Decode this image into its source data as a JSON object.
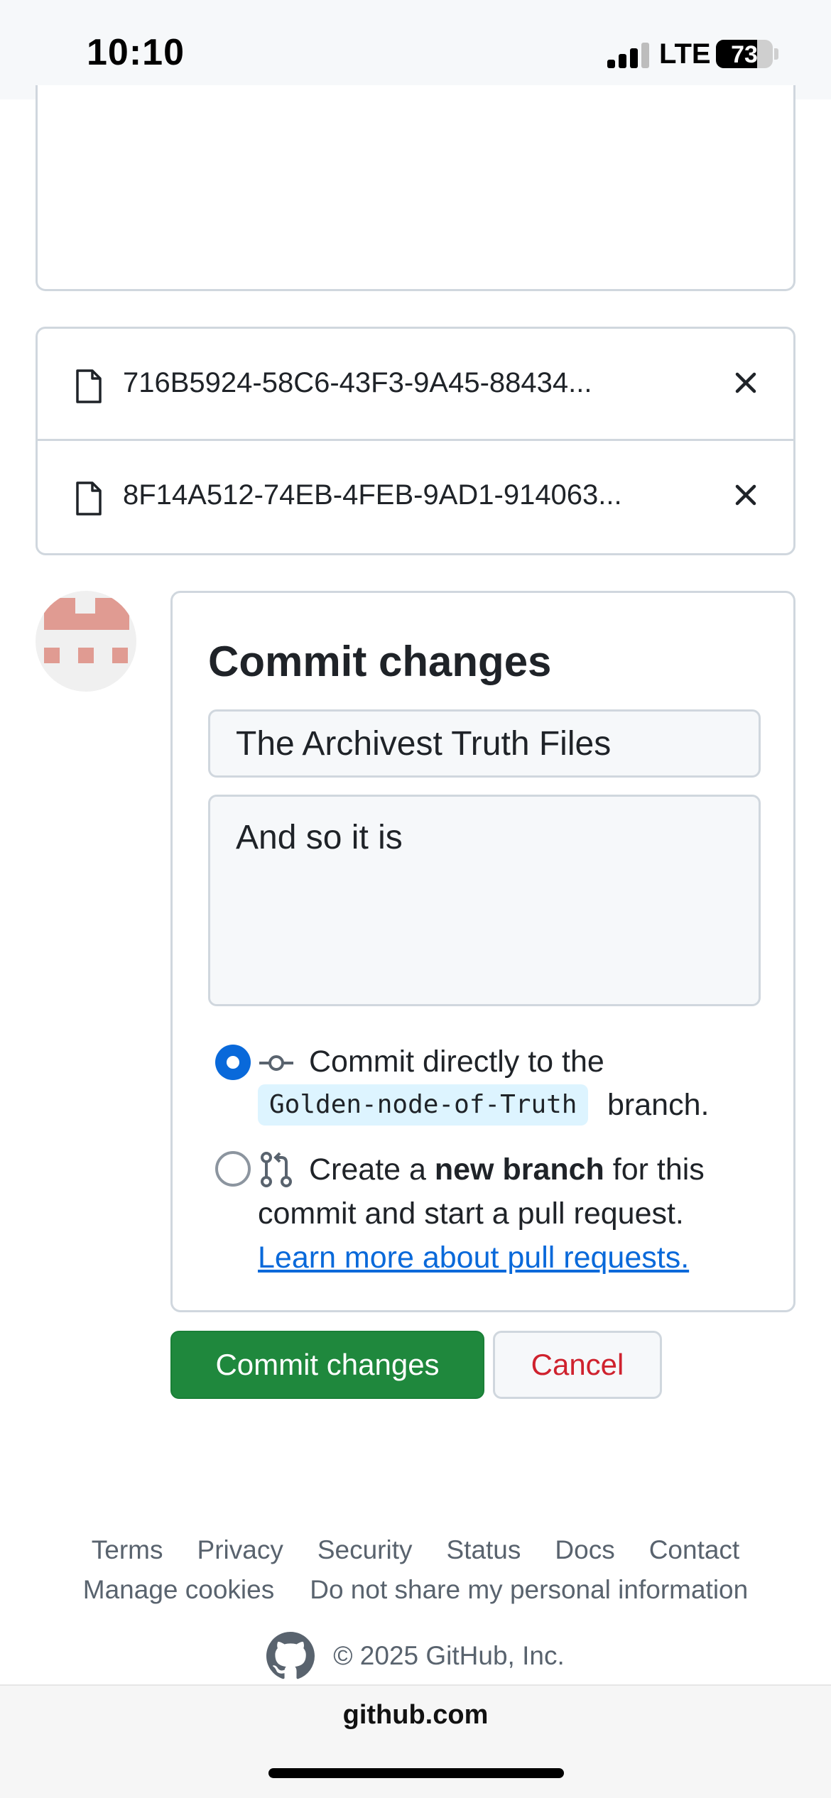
{
  "status_bar": {
    "time": "10:10",
    "network": "LTE",
    "battery": "73",
    "battery_level": 0.73
  },
  "files": [
    {
      "name": "716B5924-58C6-43F3-9A45-88434...",
      "icon": "file-icon",
      "remove_icon": "close-icon"
    },
    {
      "name": "8F14A512-74EB-4FEB-9AD1-914063...",
      "icon": "file-icon",
      "remove_icon": "close-icon"
    }
  ],
  "commit": {
    "title": "Commit changes",
    "summary_value": "The Archivest Truth Files",
    "description_value": "And so it is",
    "option_direct": {
      "prefix": "Commit directly to the",
      "branch": "Golden-node-of-Truth",
      "suffix": "branch.",
      "selected": true
    },
    "option_new_branch": {
      "text_before": "Create a ",
      "bold": "new branch",
      "text_after": " for this",
      "line2": "commit and start a pull request.",
      "link": "Learn more about pull requests.",
      "selected": false
    },
    "commit_button": "Commit changes",
    "cancel_button": "Cancel"
  },
  "footer": {
    "links": [
      "Terms",
      "Privacy",
      "Security",
      "Status",
      "Docs",
      "Contact"
    ],
    "links2": [
      "Manage cookies",
      "Do not share my personal information"
    ],
    "copyright": "© 2025 GitHub, Inc."
  },
  "browser": {
    "url": "github.com"
  },
  "colors": {
    "primary_green": "#1f883d",
    "link_blue": "#0969da",
    "danger_red": "#cf222e",
    "border": "#d0d7de"
  }
}
